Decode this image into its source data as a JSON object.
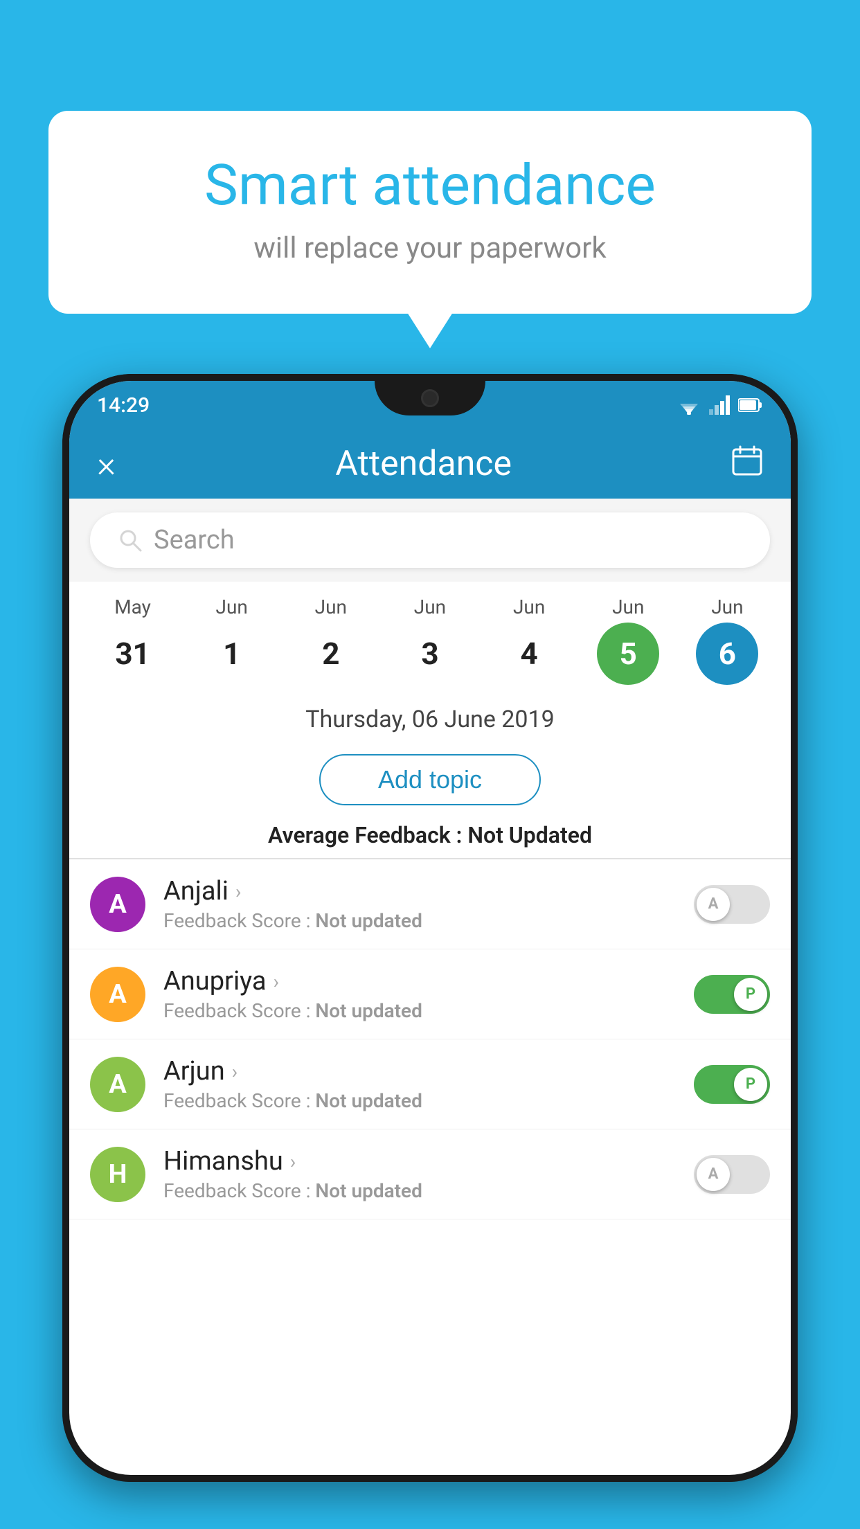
{
  "background_color": "#29b6e8",
  "speech_bubble": {
    "title": "Smart attendance",
    "subtitle": "will replace your paperwork"
  },
  "status_bar": {
    "time": "14:29"
  },
  "app_bar": {
    "title": "Attendance",
    "close_label": "×",
    "calendar_label": "📅"
  },
  "search": {
    "placeholder": "Search"
  },
  "calendar": {
    "dates": [
      {
        "month": "May",
        "day": "31",
        "state": "normal"
      },
      {
        "month": "Jun",
        "day": "1",
        "state": "normal"
      },
      {
        "month": "Jun",
        "day": "2",
        "state": "normal"
      },
      {
        "month": "Jun",
        "day": "3",
        "state": "normal"
      },
      {
        "month": "Jun",
        "day": "4",
        "state": "normal"
      },
      {
        "month": "Jun",
        "day": "5",
        "state": "today"
      },
      {
        "month": "Jun",
        "day": "6",
        "state": "selected"
      }
    ],
    "selected_date_label": "Thursday, 06 June 2019"
  },
  "add_topic_label": "Add topic",
  "avg_feedback": {
    "label": "Average Feedback : ",
    "value": "Not Updated"
  },
  "students": [
    {
      "name": "Anjali",
      "avatar_letter": "A",
      "avatar_color": "#9c27b0",
      "feedback_label": "Feedback Score : ",
      "feedback_value": "Not updated",
      "toggle_state": "off",
      "toggle_label": "A"
    },
    {
      "name": "Anupriya",
      "avatar_letter": "A",
      "avatar_color": "#ffa726",
      "feedback_label": "Feedback Score : ",
      "feedback_value": "Not updated",
      "toggle_state": "on",
      "toggle_label": "P"
    },
    {
      "name": "Arjun",
      "avatar_letter": "A",
      "avatar_color": "#8bc34a",
      "feedback_label": "Feedback Score : ",
      "feedback_value": "Not updated",
      "toggle_state": "on",
      "toggle_label": "P"
    },
    {
      "name": "Himanshu",
      "avatar_letter": "H",
      "avatar_color": "#8bc34a",
      "feedback_label": "Feedback Score : ",
      "feedback_value": "Not updated",
      "toggle_state": "off",
      "toggle_label": "A"
    }
  ]
}
